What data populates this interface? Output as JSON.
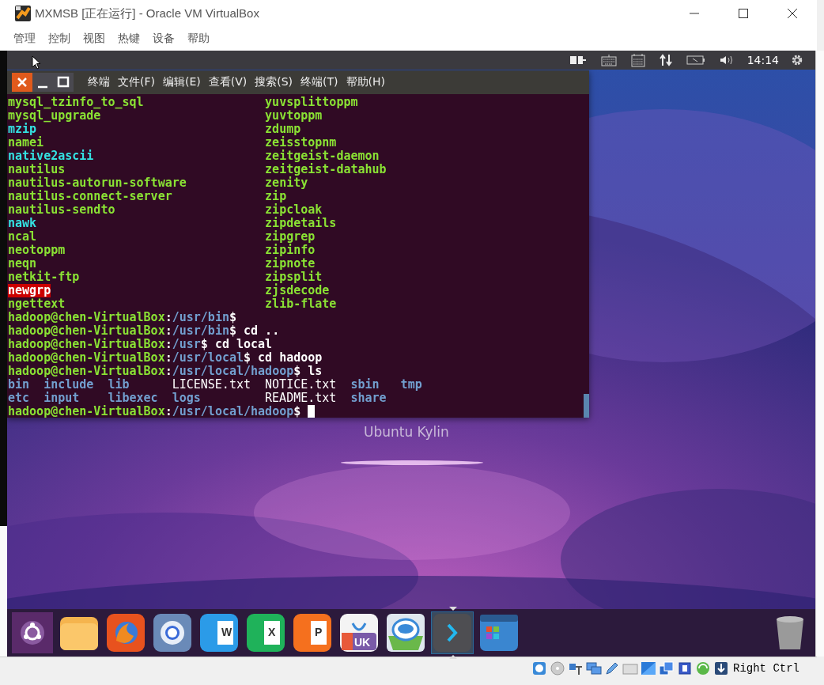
{
  "window": {
    "title": "MXMSB [正在运行] - Oracle VM VirtualBox"
  },
  "menu": [
    "管理",
    "控制",
    "视图",
    "热键",
    "设备",
    "帮助"
  ],
  "panel": {
    "clock": "14:14"
  },
  "terminal": {
    "title": "终端",
    "menu": [
      "文件(F)",
      "编辑(E)",
      "查看(V)",
      "搜索(S)",
      "终端(T)",
      "帮助(H)"
    ],
    "lines": [
      {
        "kind": "pair",
        "cells": [
          {
            "text": "mysql_tzinfo_to_sql",
            "kind": "exec"
          },
          {
            "text": "yuvsplittoppm",
            "kind": "exec"
          }
        ]
      },
      {
        "kind": "pair",
        "cells": [
          {
            "text": "mysql_upgrade",
            "kind": "exec"
          },
          {
            "text": "yuvtoppm",
            "kind": "exec"
          }
        ]
      },
      {
        "kind": "pair",
        "cells": [
          {
            "text": "mzip",
            "kind": "link"
          },
          {
            "text": "zdump",
            "kind": "exec"
          }
        ]
      },
      {
        "kind": "pair",
        "cells": [
          {
            "text": "namei",
            "kind": "exec"
          },
          {
            "text": "zeisstopnm",
            "kind": "exec"
          }
        ]
      },
      {
        "kind": "pair",
        "cells": [
          {
            "text": "native2ascii",
            "kind": "link"
          },
          {
            "text": "zeitgeist-daemon",
            "kind": "exec"
          }
        ]
      },
      {
        "kind": "pair",
        "cells": [
          {
            "text": "nautilus",
            "kind": "exec"
          },
          {
            "text": "zeitgeist-datahub",
            "kind": "exec"
          }
        ]
      },
      {
        "kind": "pair",
        "cells": [
          {
            "text": "nautilus-autorun-software",
            "kind": "exec"
          },
          {
            "text": "zenity",
            "kind": "exec"
          }
        ]
      },
      {
        "kind": "pair",
        "cells": [
          {
            "text": "nautilus-connect-server",
            "kind": "exec"
          },
          {
            "text": "zip",
            "kind": "exec"
          }
        ]
      },
      {
        "kind": "pair",
        "cells": [
          {
            "text": "nautilus-sendto",
            "kind": "exec"
          },
          {
            "text": "zipcloak",
            "kind": "exec"
          }
        ]
      },
      {
        "kind": "pair",
        "cells": [
          {
            "text": "nawk",
            "kind": "link"
          },
          {
            "text": "zipdetails",
            "kind": "exec"
          }
        ]
      },
      {
        "kind": "pair",
        "cells": [
          {
            "text": "ncal",
            "kind": "exec"
          },
          {
            "text": "zipgrep",
            "kind": "exec"
          }
        ]
      },
      {
        "kind": "pair",
        "cells": [
          {
            "text": "neotoppm",
            "kind": "exec"
          },
          {
            "text": "zipinfo",
            "kind": "exec"
          }
        ]
      },
      {
        "kind": "pair",
        "cells": [
          {
            "text": "neqn",
            "kind": "exec"
          },
          {
            "text": "zipnote",
            "kind": "exec"
          }
        ]
      },
      {
        "kind": "pair",
        "cells": [
          {
            "text": "netkit-ftp",
            "kind": "exec"
          },
          {
            "text": "zipsplit",
            "kind": "exec"
          }
        ]
      },
      {
        "kind": "pair",
        "cells": [
          {
            "text": "newgrp",
            "kind": "setuid"
          },
          {
            "text": "zjsdecode",
            "kind": "exec"
          }
        ]
      },
      {
        "kind": "pair",
        "cells": [
          {
            "text": "ngettext",
            "kind": "exec"
          },
          {
            "text": "zlib-flate",
            "kind": "exec"
          }
        ]
      },
      {
        "kind": "prompt",
        "cursor": false,
        "segments": [
          {
            "text": "hadoop@chen-VirtualBox",
            "kind": "user"
          },
          {
            "text": ":",
            "kind": "plain"
          },
          {
            "text": "/usr/bin",
            "kind": "path"
          },
          {
            "text": "$",
            "kind": "plain"
          }
        ]
      },
      {
        "kind": "prompt",
        "cursor": false,
        "segments": [
          {
            "text": "hadoop@chen-VirtualBox",
            "kind": "user"
          },
          {
            "text": ":",
            "kind": "plain"
          },
          {
            "text": "/usr/bin",
            "kind": "path"
          },
          {
            "text": "$ cd ..",
            "kind": "plain"
          }
        ]
      },
      {
        "kind": "prompt",
        "cursor": false,
        "segments": [
          {
            "text": "hadoop@chen-VirtualBox",
            "kind": "user"
          },
          {
            "text": ":",
            "kind": "plain"
          },
          {
            "text": "/usr",
            "kind": "path"
          },
          {
            "text": "$ cd local",
            "kind": "plain"
          }
        ]
      },
      {
        "kind": "prompt",
        "cursor": false,
        "segments": [
          {
            "text": "hadoop@chen-VirtualBox",
            "kind": "user"
          },
          {
            "text": ":",
            "kind": "plain"
          },
          {
            "text": "/usr/local",
            "kind": "path"
          },
          {
            "text": "$ cd hadoop",
            "kind": "plain"
          }
        ]
      },
      {
        "kind": "prompt",
        "cursor": false,
        "segments": [
          {
            "text": "hadoop@chen-VirtualBox",
            "kind": "user"
          },
          {
            "text": ":",
            "kind": "plain"
          },
          {
            "text": "/usr/local/hadoop",
            "kind": "path"
          },
          {
            "text": "$ ls",
            "kind": "plain"
          }
        ]
      },
      {
        "kind": "ls",
        "cells": [
          {
            "text": "bin",
            "kind": "dir"
          },
          {
            "text": "include",
            "kind": "dir"
          },
          {
            "text": "lib",
            "kind": "dir"
          },
          {
            "text": "LICENSE.txt",
            "kind": "file"
          },
          {
            "text": "NOTICE.txt",
            "kind": "file"
          },
          {
            "text": "sbin",
            "kind": "dir"
          },
          {
            "text": "tmp",
            "kind": "dir"
          }
        ]
      },
      {
        "kind": "ls",
        "cells": [
          {
            "text": "etc",
            "kind": "dir"
          },
          {
            "text": "input",
            "kind": "dir"
          },
          {
            "text": "libexec",
            "kind": "dir"
          },
          {
            "text": "logs",
            "kind": "dir"
          },
          {
            "text": "README.txt",
            "kind": "file"
          },
          {
            "text": "share",
            "kind": "dir"
          }
        ]
      },
      {
        "kind": "prompt",
        "cursor": true,
        "segments": [
          {
            "text": "hadoop@chen-VirtualBox",
            "kind": "user"
          },
          {
            "text": ":",
            "kind": "plain"
          },
          {
            "text": "/usr/local/hadoop",
            "kind": "path"
          },
          {
            "text": "$",
            "kind": "plain"
          }
        ]
      }
    ]
  },
  "desktop": {
    "label": "Ubuntu Kylin"
  },
  "dock": {
    "items": [
      {
        "kind": "dash",
        "selected": false
      },
      {
        "kind": "folder",
        "selected": false
      },
      {
        "kind": "firefox",
        "selected": false
      },
      {
        "kind": "browser",
        "selected": false
      },
      {
        "kind": "word",
        "label": "W",
        "selected": false
      },
      {
        "kind": "excel",
        "label": "X",
        "selected": false
      },
      {
        "kind": "slides",
        "label": "P",
        "selected": false
      },
      {
        "kind": "store",
        "label": "UK",
        "selected": false
      },
      {
        "kind": "robot",
        "selected": false
      },
      {
        "kind": "terminal",
        "selected": true
      },
      {
        "kind": "apps",
        "selected": false
      }
    ]
  },
  "status_bar": {
    "host_key": "Right Ctrl"
  }
}
